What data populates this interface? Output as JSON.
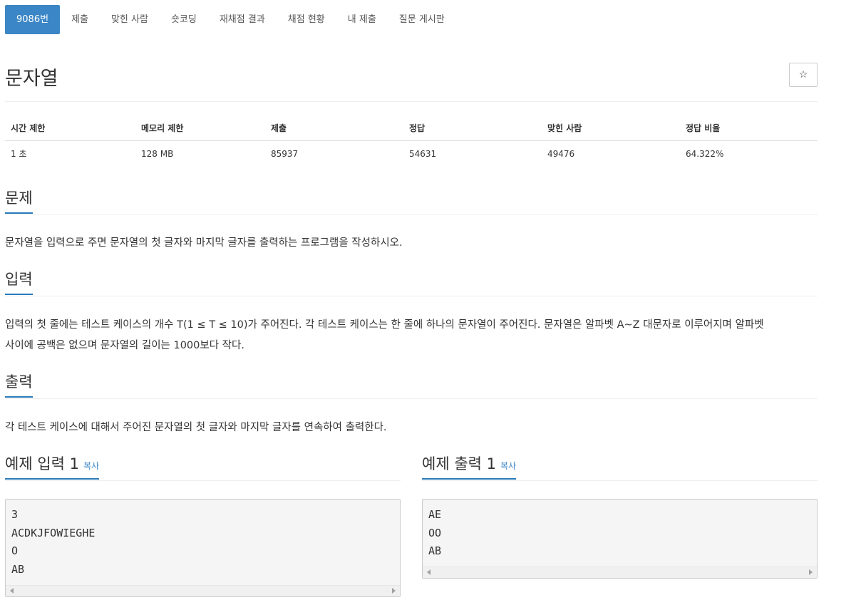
{
  "nav": {
    "items": [
      {
        "label": "9086번"
      },
      {
        "label": "제출"
      },
      {
        "label": "맞힌 사람"
      },
      {
        "label": "숏코딩"
      },
      {
        "label": "재채점 결과"
      },
      {
        "label": "채점 현황"
      },
      {
        "label": "내 제출"
      },
      {
        "label": "질문 게시판"
      }
    ],
    "active_index": 0
  },
  "problem": {
    "title": "문자열",
    "star_icon": "☆"
  },
  "stats": {
    "headers": [
      "시간 제한",
      "메모리 제한",
      "제출",
      "정답",
      "맞힌 사람",
      "정답 비율"
    ],
    "values": [
      "1 초",
      "128 MB",
      "85937",
      "54631",
      "49476",
      "64.322%"
    ]
  },
  "sections": {
    "problem": {
      "title": "문제",
      "text": "문자열을 입력으로 주면 문자열의 첫 글자와 마지막 글자를 출력하는 프로그램을 작성하시오."
    },
    "input": {
      "title": "입력",
      "line1": "입력의 첫 줄에는 테스트 케이스의 개수 T(1 ≤ T ≤ 10)가 주어진다. 각 테스트 케이스는 한 줄에 하나의 문자열이 주어진다. 문자열은 알파벳 A~Z 대문자로 이루어지며 알파벳",
      "line2": "사이에 공백은 없으며 문자열의 길이는 1000보다 작다."
    },
    "output": {
      "title": "출력",
      "text": "각 테스트 케이스에 대해서 주어진 문자열의 첫 글자와 마지막 글자를 연속하여 출력한다."
    }
  },
  "examples": {
    "input": {
      "title": "예제 입력 1",
      "copy_label": "복사",
      "content": "3\nACDKJFOWIEGHE\nO\nAB"
    },
    "output": {
      "title": "예제 출력 1",
      "copy_label": "복사",
      "content": "AE\nOO\nAB"
    }
  },
  "colors": {
    "accent": "#3b86c6",
    "underline": "#2a7ab9",
    "pre_bg": "#f5f5f5"
  }
}
